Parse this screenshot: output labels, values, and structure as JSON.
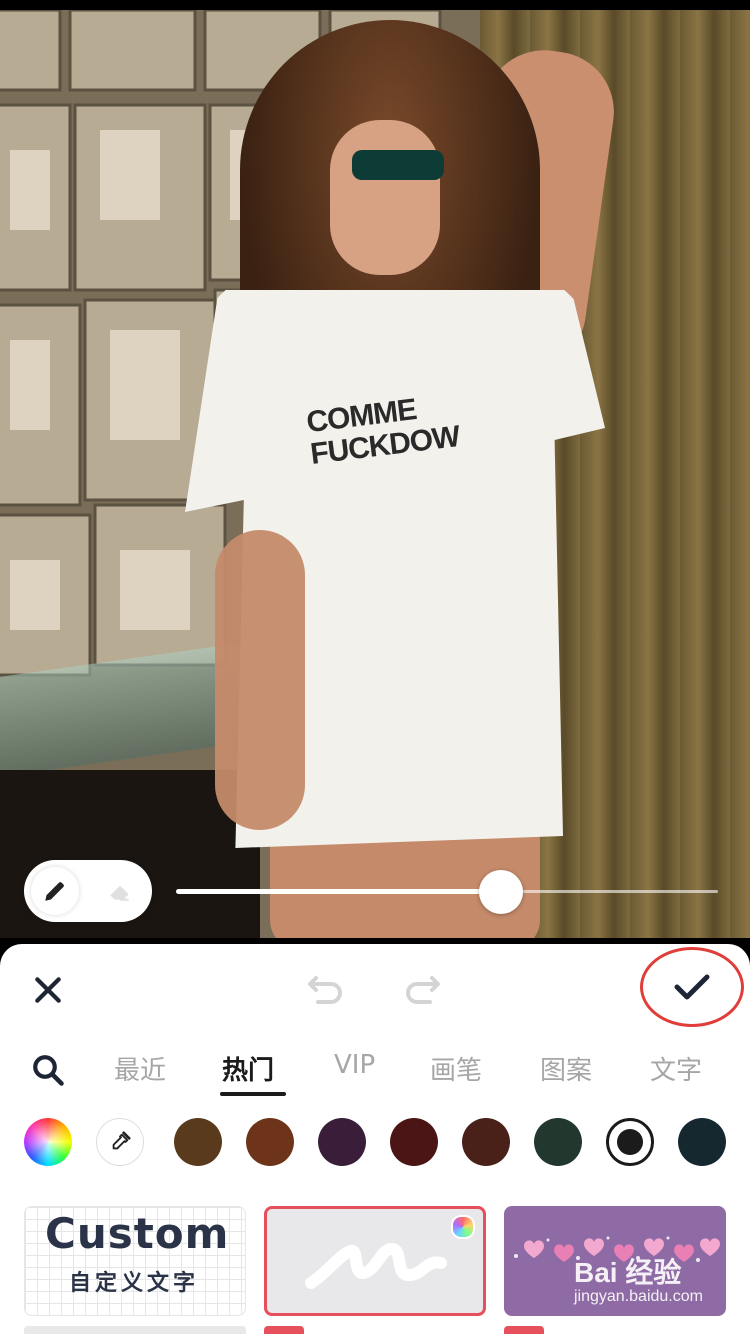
{
  "toolbar": {
    "close_icon": "close-icon",
    "undo_icon": "undo-icon",
    "redo_icon": "redo-icon",
    "confirm_icon": "checkmark-icon",
    "highlight_color": "#e03e3a"
  },
  "photo": {
    "shirt_text_line1": "COMME",
    "shirt_text_line2": "FUCKDOW",
    "brush_tools": [
      "pen-icon",
      "eraser-icon"
    ],
    "brush_size_fraction": 0.6
  },
  "tabs": {
    "search_icon": "search-icon",
    "items": [
      {
        "label": "最近"
      },
      {
        "label": "热门",
        "active": true
      },
      {
        "label": "VIP"
      },
      {
        "label": "画笔"
      },
      {
        "label": "图案"
      },
      {
        "label": "文字"
      }
    ]
  },
  "colors": {
    "wheel": "color-wheel",
    "picker": "eyedropper-icon",
    "swatches": [
      "#5a3a1d",
      "#6e3419",
      "#3a1d38",
      "#4c1515",
      "#4a2118",
      "#22382f",
      "#1b1b1b",
      "#16282f"
    ],
    "selected_index": 6
  },
  "cards": {
    "custom_title": "Custom",
    "custom_subtitle": "自定义文字",
    "brush_accent": "#e6505d"
  },
  "watermark": {
    "main": "Bai 经验",
    "sub": "jingyan.baidu.com"
  }
}
